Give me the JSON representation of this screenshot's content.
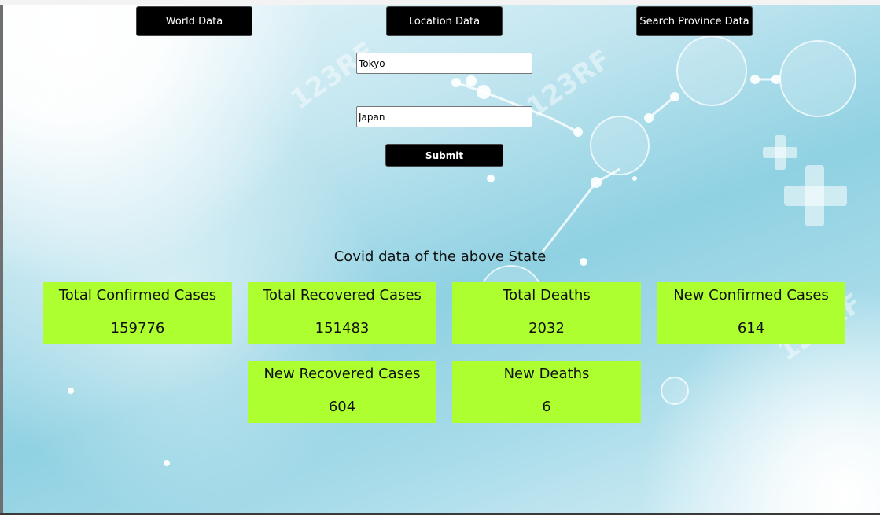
{
  "nav": {
    "world_label": "World Data",
    "location_label": "Location Data",
    "province_label": "Search Province Data"
  },
  "form": {
    "city_value": "Tokyo",
    "country_value": "Japan",
    "submit_label": "Submit"
  },
  "section": {
    "title": "Covid data of the above State"
  },
  "cards": [
    {
      "label": "Total Confirmed Cases",
      "value": "159776"
    },
    {
      "label": "Total Recovered Cases",
      "value": "151483"
    },
    {
      "label": "Total Deaths",
      "value": "2032"
    },
    {
      "label": "New Confirmed Cases",
      "value": "614"
    },
    {
      "label": "New Recovered Cases",
      "value": "604"
    },
    {
      "label": "New Deaths",
      "value": "6"
    }
  ],
  "colors": {
    "card_background": "#adff2f",
    "button_background": "#000000",
    "button_text": "#ffffff"
  },
  "background": {
    "watermark_text": "123RF"
  }
}
